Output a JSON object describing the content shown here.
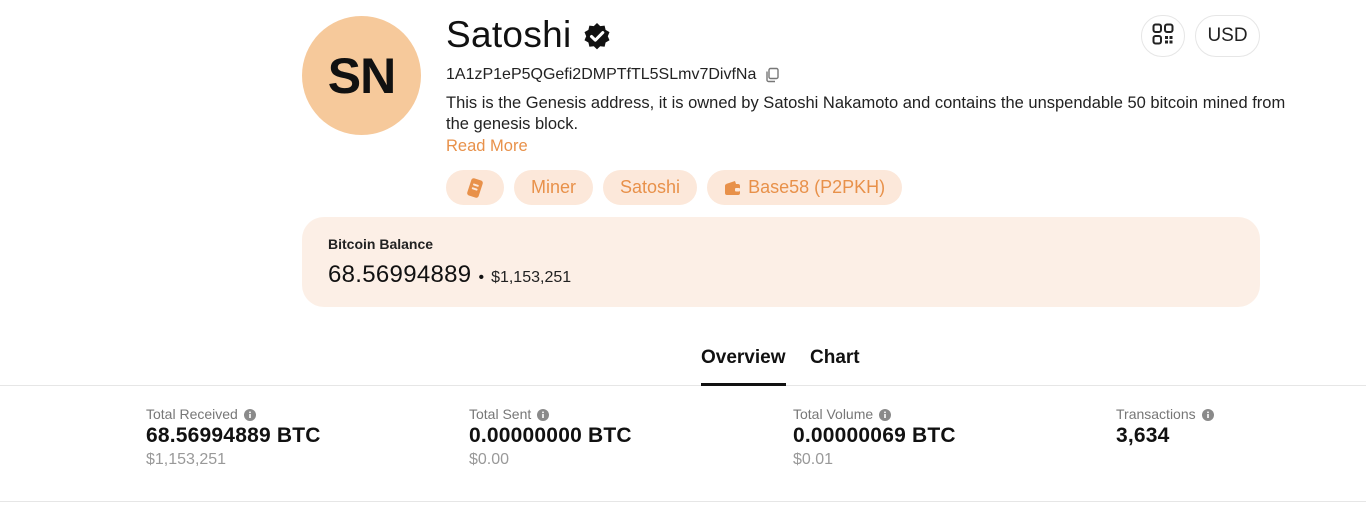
{
  "profile": {
    "initials": "SN",
    "name": "Satoshi",
    "address": "1A1zP1eP5QGefi2DMPTfTL5SLmv7DivfNa",
    "description": "This is the Genesis address, it is owned by Satoshi Nakamoto and contains the unspendable 50 bitcoin mined from the genesis block.",
    "read_more": "Read More",
    "tags": [
      {
        "icon": "tag-icon"
      },
      {
        "label": "Miner"
      },
      {
        "label": "Satoshi"
      },
      {
        "icon": "wallet-icon",
        "label": "Base58 (P2PKH)"
      }
    ]
  },
  "header": {
    "qr_icon": "qr-code-icon",
    "currency": "USD"
  },
  "balance": {
    "label": "Bitcoin Balance",
    "btc": "68.56994889",
    "separator": "•",
    "usd": "$1,153,251"
  },
  "tabs": [
    {
      "label": "Overview",
      "active": true
    },
    {
      "label": "Chart",
      "active": false
    }
  ],
  "stats": [
    {
      "label": "Total Received",
      "value": "68.56994889 BTC",
      "usd": "$1,153,251"
    },
    {
      "label": "Total Sent",
      "value": "0.00000000 BTC",
      "usd": "$0.00"
    },
    {
      "label": "Total Volume",
      "value": "0.00000069 BTC",
      "usd": "$0.01"
    },
    {
      "label": "Transactions",
      "value": "3,634"
    }
  ],
  "colors": {
    "accent": "#e8914a",
    "tag_bg": "#fce8da",
    "avatar_bg": "#f6c99b",
    "card_bg": "#fcefe6"
  }
}
